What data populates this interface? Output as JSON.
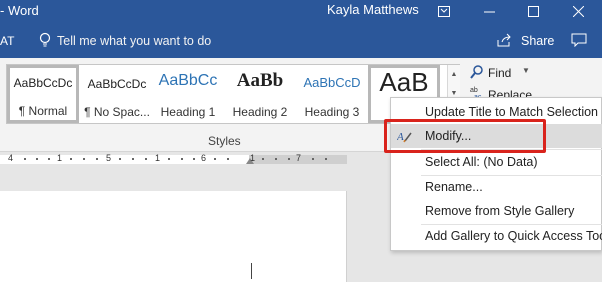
{
  "titlebar": {
    "app_title": "- Word",
    "user_name": "Kayla Matthews",
    "icons": [
      "ribbon-display-icon",
      "minimize-icon",
      "maximize-icon",
      "close-icon"
    ]
  },
  "tellbar": {
    "partial_tab": "AT",
    "tell_me": "Tell me what you want to do",
    "share": "Share"
  },
  "styles_group": {
    "label": "Styles",
    "tiles": [
      {
        "preview": "AaBbCcDc",
        "name": "¶ Normal"
      },
      {
        "preview": "AaBbCcDc",
        "name": "¶ No Spac..."
      },
      {
        "preview": "AaBbCc",
        "name": "Heading 1"
      },
      {
        "preview": "AaBb",
        "name": "Heading 2"
      },
      {
        "preview": "AaBbCcD",
        "name": "Heading 3"
      },
      {
        "preview": "AaB",
        "name": ""
      }
    ]
  },
  "editing_group": {
    "find": "Find",
    "replace": "Replace"
  },
  "ruler": {
    "numbers": [
      "4",
      "1",
      "5",
      "1",
      "6",
      "1",
      "7"
    ]
  },
  "context_menu": {
    "items": [
      {
        "label": "Update Title to Match Selection"
      },
      {
        "label": "Modify..."
      },
      {
        "label": "Select All: (No Data)"
      },
      {
        "label": "Rename..."
      },
      {
        "label": "Remove from Style Gallery"
      },
      {
        "label": "Add Gallery to Quick Access Toolb"
      }
    ],
    "highlight_color": "#d9231c"
  },
  "colors": {
    "accent": "#2b579a",
    "highlight_box": "#d9231c"
  }
}
